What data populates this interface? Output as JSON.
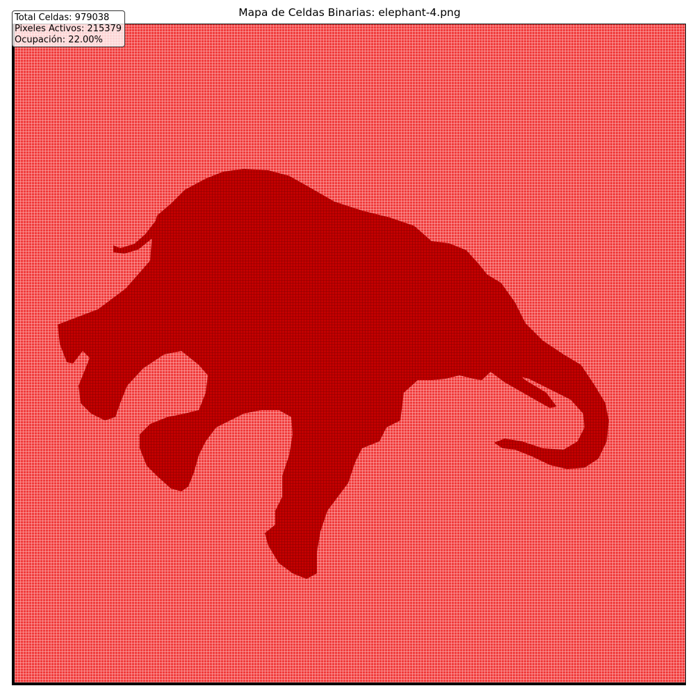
{
  "chart_data": {
    "type": "heatmap",
    "title": "Mapa de Celdas Binarias: elephant-4.png",
    "stats": [
      "Total Celdas: 979038",
      "Pixeles Activos: 215379",
      "Ocupación: 22.00%"
    ],
    "xlabel": "",
    "ylabel": "",
    "grid": true,
    "legend": "none"
  },
  "colors": {
    "inactive": "#f03c3c",
    "active": "#c00000",
    "grid_line": "#ffbebe",
    "frame": "#000000"
  }
}
